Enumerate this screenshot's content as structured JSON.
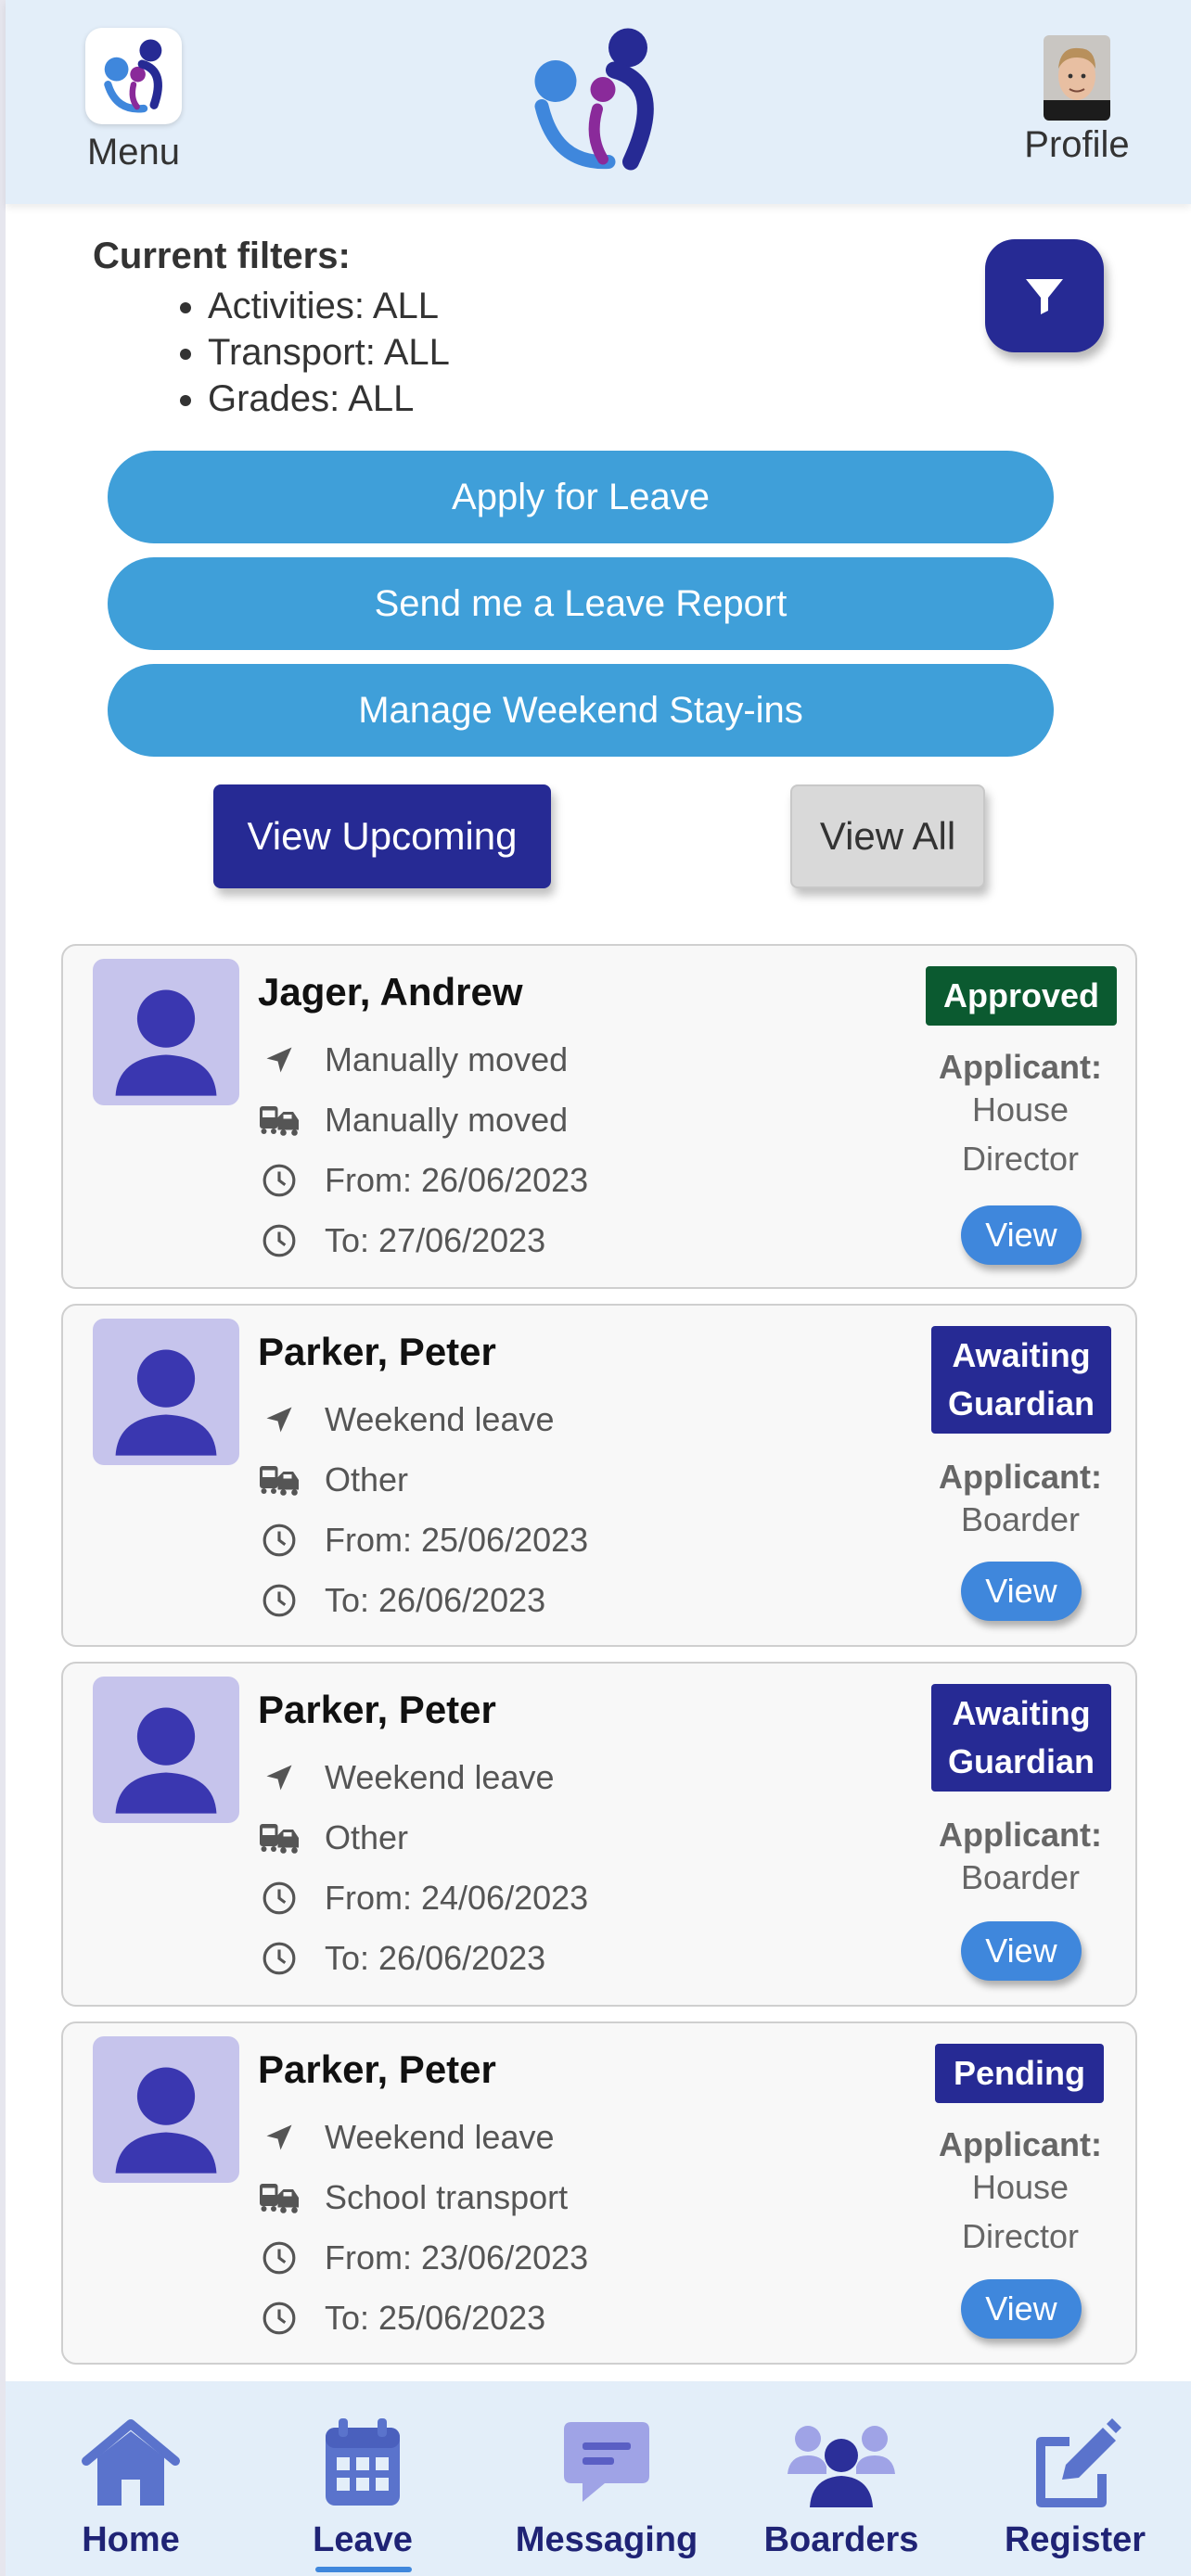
{
  "header": {
    "menu_label": "Menu",
    "profile_label": "Profile"
  },
  "filters": {
    "title": "Current filters:",
    "items": [
      "Activities: ALL",
      "Transport: ALL",
      "Grades: ALL"
    ]
  },
  "actions": {
    "apply_leave": "Apply for Leave",
    "leave_report": "Send me a Leave Report",
    "weekend_stayins": "Manage Weekend Stay-ins"
  },
  "view_toggle": {
    "upcoming": "View Upcoming",
    "all": "View All",
    "selected": "upcoming"
  },
  "leave_list": [
    {
      "name": "Jager, Andrew",
      "leave_type": "Manually moved",
      "transport": "Manually moved",
      "from": "From: 26/06/2023",
      "to": "To: 27/06/2023",
      "status": [
        "Approved"
      ],
      "status_color": "#0b5a30",
      "applicant_label": "Applicant:",
      "applicant": [
        "House",
        "Director"
      ],
      "view_label": "View"
    },
    {
      "name": "Parker, Peter",
      "leave_type": "Weekend leave",
      "transport": "Other",
      "from": "From: 25/06/2023",
      "to": "To: 26/06/2023",
      "status": [
        "Awaiting",
        "Guardian"
      ],
      "status_color": "#262a94",
      "applicant_label": "Applicant:",
      "applicant": [
        "Boarder"
      ],
      "view_label": "View"
    },
    {
      "name": "Parker, Peter",
      "leave_type": "Weekend leave",
      "transport": "Other",
      "from": "From: 24/06/2023",
      "to": "To: 26/06/2023",
      "status": [
        "Awaiting",
        "Guardian"
      ],
      "status_color": "#262a94",
      "applicant_label": "Applicant:",
      "applicant": [
        "Boarder"
      ],
      "view_label": "View"
    },
    {
      "name": "Parker, Peter",
      "leave_type": "Weekend leave",
      "transport": "School transport",
      "from": "From: 23/06/2023",
      "to": "To: 25/06/2023",
      "status": [
        "Pending"
      ],
      "status_color": "#262a94",
      "applicant_label": "Applicant:",
      "applicant": [
        "House",
        "Director"
      ],
      "view_label": "View"
    }
  ],
  "bottom_nav": {
    "items": [
      {
        "label": "Home",
        "icon": "home-icon"
      },
      {
        "label": "Leave",
        "icon": "calendar-icon"
      },
      {
        "label": "Messaging",
        "icon": "message-icon"
      },
      {
        "label": "Boarders",
        "icon": "users-icon"
      },
      {
        "label": "Register",
        "icon": "edit-icon"
      }
    ],
    "active": "Leave"
  },
  "colors": {
    "primary_dark": "#262a94",
    "pill_blue": "#3f9fd9",
    "view_blue": "#3f87dc",
    "approved_green": "#0b5a30",
    "header_bg": "#e3eef9"
  }
}
